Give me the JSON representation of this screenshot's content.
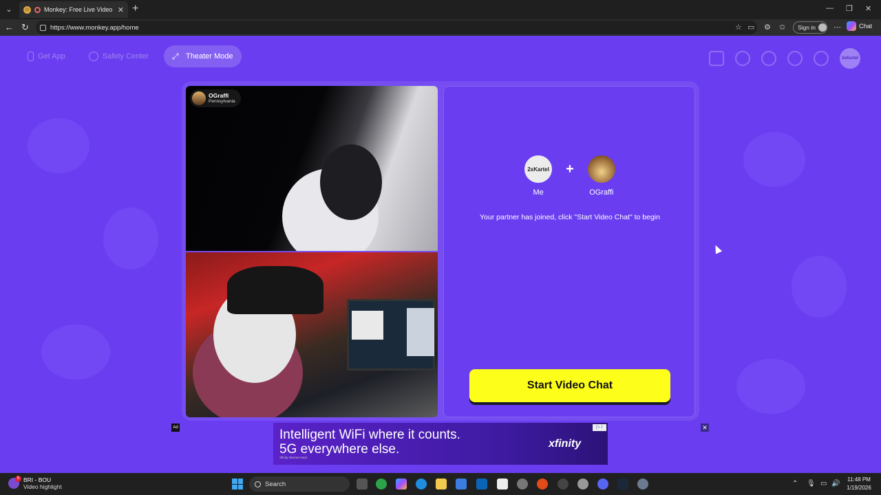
{
  "browser": {
    "tab_title": "Monkey: Free Live Video Chat",
    "url": "https://www.monkey.app/home",
    "signin_label": "Sign in",
    "chat_label": "Chat"
  },
  "nav": {
    "get_app": "Get App",
    "safety_center": "Safety Center",
    "theater_mode": "Theater Mode",
    "profile_avatar_text": "2xKartel"
  },
  "partner_video": {
    "username": "OGraffi",
    "location": "Pennsylvania"
  },
  "match_panel": {
    "me_avatar_text": "2xKartel",
    "me_label": "Me",
    "plus": "+",
    "partner_label": "OGraffi",
    "message": "Your partner has joined, click \"Start Video Chat\" to begin",
    "start_button": "Start Video Chat"
  },
  "ad": {
    "label": "Ad",
    "line1": "Intelligent WiFi where it counts.",
    "line2": "5G everywhere else.",
    "fine_print": "Xfinity Internet req'd.",
    "brand": "xfinity",
    "close": "✕"
  },
  "taskbar": {
    "widget_title": "BRI - BOU",
    "widget_subtitle": "Video highlight",
    "widget_badge": "5",
    "search_label": "Search",
    "time": "11:48 PM",
    "date": "1/19/2026"
  },
  "colors": {
    "page_bg": "#6a3ef0",
    "start_button": "#fdff1a"
  }
}
